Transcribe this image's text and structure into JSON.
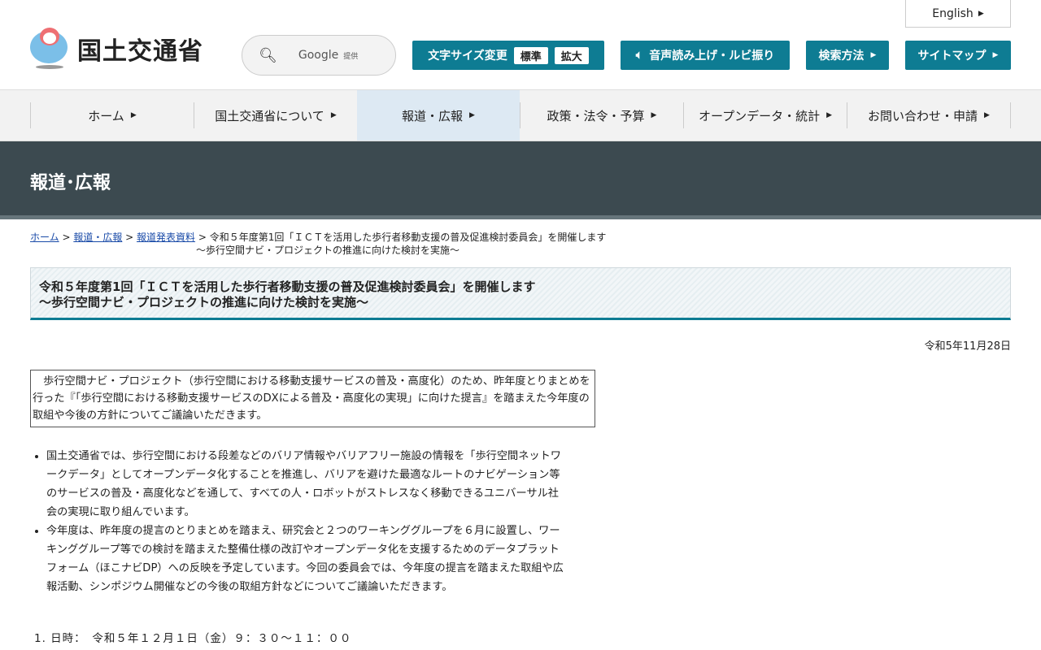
{
  "header": {
    "logo": "国土交通省",
    "english": "English",
    "search_brand": "Google",
    "search_provided": "提供",
    "font_size_label": "文字サイズ変更",
    "font_standard": "標準",
    "font_large": "拡大",
    "speech": "音声読み上げ・ルビ振り",
    "search_method": "検索方法",
    "sitemap": "サイトマップ"
  },
  "nav": [
    "ホーム",
    "国土交通省について",
    "報道・広報",
    "政策・法令・予算",
    "オープンデータ・統計",
    "お問い合わせ・申請"
  ],
  "band_title": "報道･広報",
  "breadcrumb": {
    "home": "ホーム",
    "press": "報道・広報",
    "releases": "報道発表資料",
    "current1": "令和５年度第1回「ＩＣＴを活用した歩行者移動支援の普及促進検討委員会」を開催します",
    "current2": "～歩行空間ナビ・プロジェクトの推進に向けた検討を実施～"
  },
  "title": {
    "line1": "令和５年度第1回「ＩＣＴを活用した歩行者移動支援の普及促進検討委員会」を開催します",
    "line2": "～歩行空間ナビ・プロジェクトの推進に向けた検討を実施～"
  },
  "date": "令和5年11月28日",
  "intro": "　歩行空間ナビ・プロジェクト（歩行空間における移動支援サービスの普及・高度化）のため、昨年度とりまとめを行った『「歩行空間における移動支援サービスのDXによる普及・高度化の実現」に向けた提言』を踏まえた今年度の取組や今後の方針についてご議論いただきます。",
  "bullets": [
    "国土交通省では、歩行空間における段差などのバリア情報やバリアフリー施設の情報を「歩行空間ネットワークデータ」としてオープンデータ化することを推進し、バリアを避けた最適なルートのナビゲーション等のサービスの普及・高度化などを通して、すべての人・ロボットがストレスなく移動できるユニバーサル社会の実現に取り組んでいます。",
    "今年度は、昨年度の提言のとりまとめを踏まえ、研究会と２つのワーキンググループを６月に設置し、ワーキンググループ等での検討を踏まえた整備仕様の改訂やオープンデータ化を支援するためのデータプラットフォーム（ほこナビDP）への反映を予定しています。今回の委員会では、今年度の提言を踏まえた取組や広報活動、シンポジウム開催などの今後の取組方針などについてご議論いただきます。"
  ],
  "item1": "1. 日時：　令和５年１２月１日（金）９：３０～１１：００"
}
